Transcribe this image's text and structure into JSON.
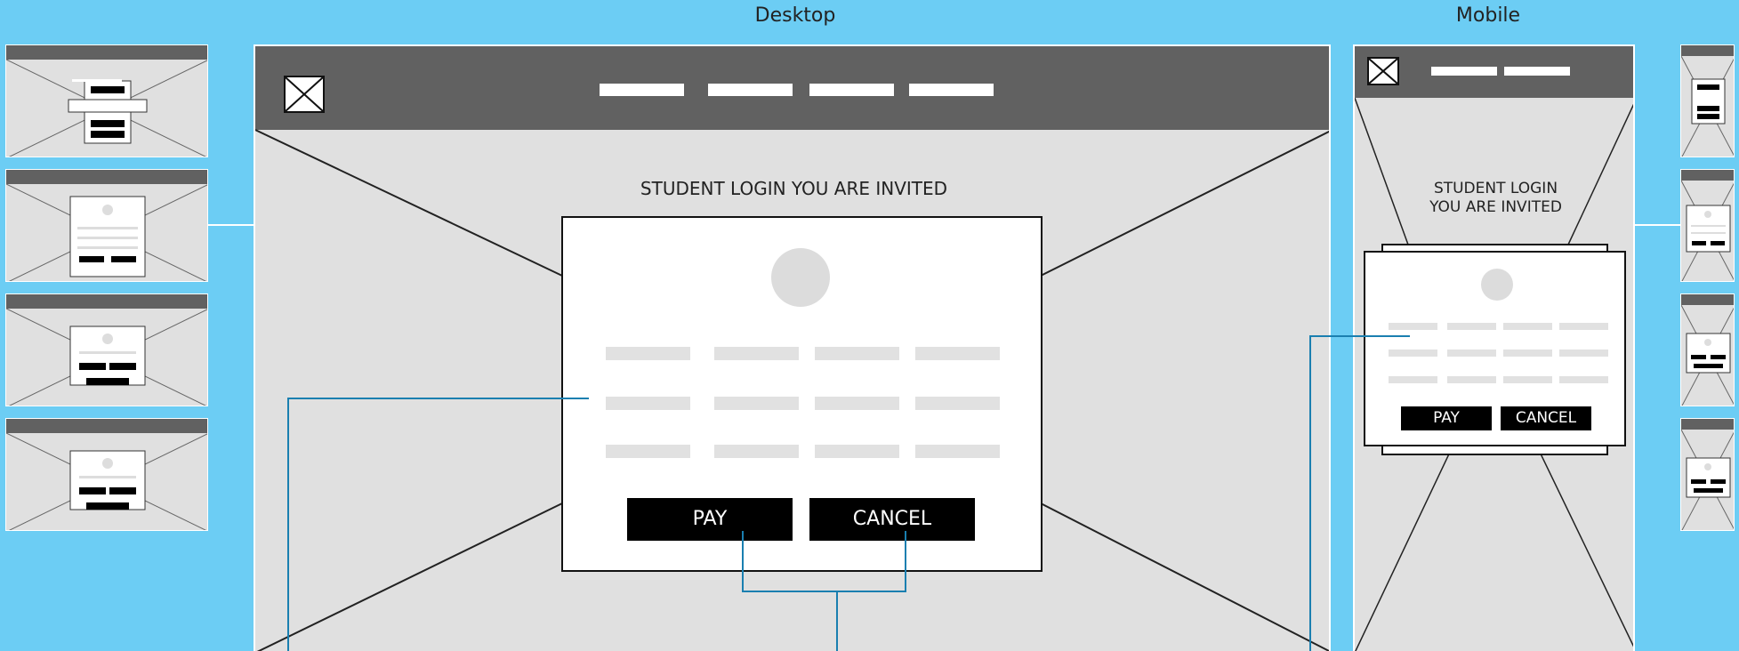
{
  "labels": {
    "desktop": "Desktop",
    "mobile": "Mobile"
  },
  "desktop_screen": {
    "nav_links": [
      "",
      "",
      "",
      ""
    ],
    "title": "STUDENT LOGIN YOU ARE INVITED",
    "pay_button": "PAY",
    "cancel_button": "CANCEL"
  },
  "mobile_screen": {
    "title_line1": "STUDENT LOGIN",
    "title_line2": "YOU ARE INVITED",
    "pay_button": "PAY",
    "cancel_button": "CANCEL"
  },
  "colors": {
    "background": "#6ccdf4",
    "navbar": "#616161",
    "screen": "#e0e0e0",
    "connector": "#1a7fb0",
    "button": "#000000"
  },
  "icons": {
    "logo": "image-placeholder-icon"
  }
}
